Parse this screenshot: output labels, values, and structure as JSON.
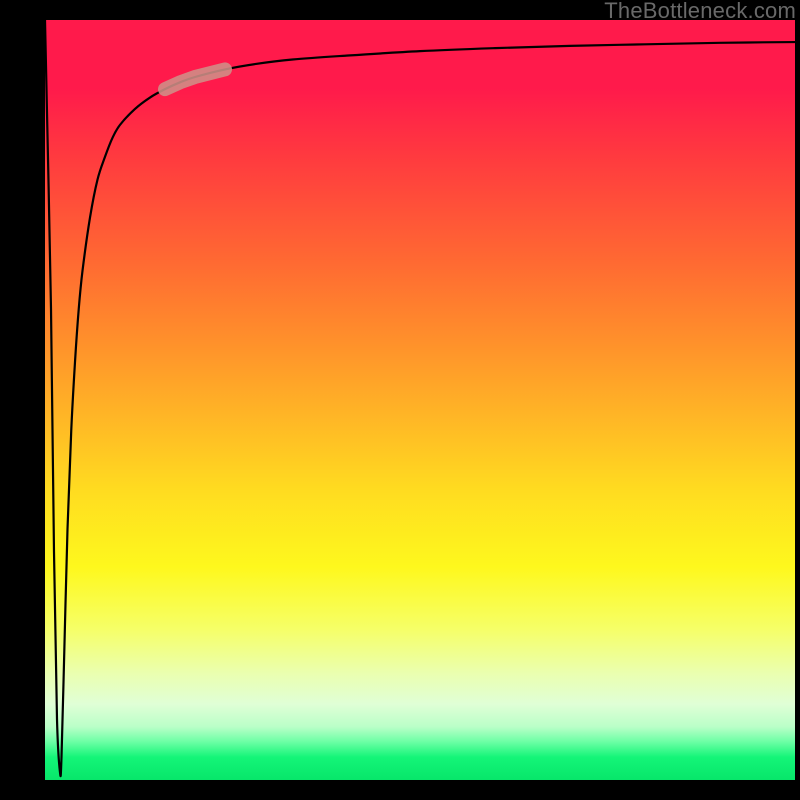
{
  "attribution": "TheBottleneck.com",
  "colors": {
    "frame": "#000000",
    "curve": "#000000",
    "highlight": "#cf8f87",
    "gradient_top": "#ff1a4b",
    "gradient_bottom": "#07e66a"
  },
  "chart_data": {
    "type": "line",
    "title": "",
    "xlabel": "",
    "ylabel": "",
    "xlim": [
      0,
      100
    ],
    "ylim": [
      0,
      100
    ],
    "x": [
      0,
      0.8,
      1.2,
      1.6,
      2.0,
      2.2,
      2.6,
      3.0,
      3.5,
      4.0,
      4.5,
      5.0,
      6.0,
      7.0,
      8.0,
      9.0,
      10.0,
      12.0,
      14.0,
      16.0,
      18.0,
      20.0,
      24.0,
      28.0,
      33.0,
      40.0,
      50.0,
      60.0,
      70.0,
      80.0,
      90.0,
      100.0
    ],
    "series": [
      {
        "name": "curve",
        "values": [
          100,
          62,
          30,
          8,
          1,
          3,
          18,
          33,
          46,
          55,
          62,
          67,
          74,
          79,
          82,
          84.5,
          86.2,
          88.3,
          89.8,
          90.9,
          91.8,
          92.5,
          93.5,
          94.2,
          94.8,
          95.3,
          95.9,
          96.3,
          96.6,
          96.8,
          97.0,
          97.1
        ]
      }
    ],
    "highlight_region": {
      "x_start": 16.0,
      "x_end": 24.0,
      "y_start": 90.9,
      "y_end": 93.5
    },
    "grid": false,
    "legend": false
  }
}
